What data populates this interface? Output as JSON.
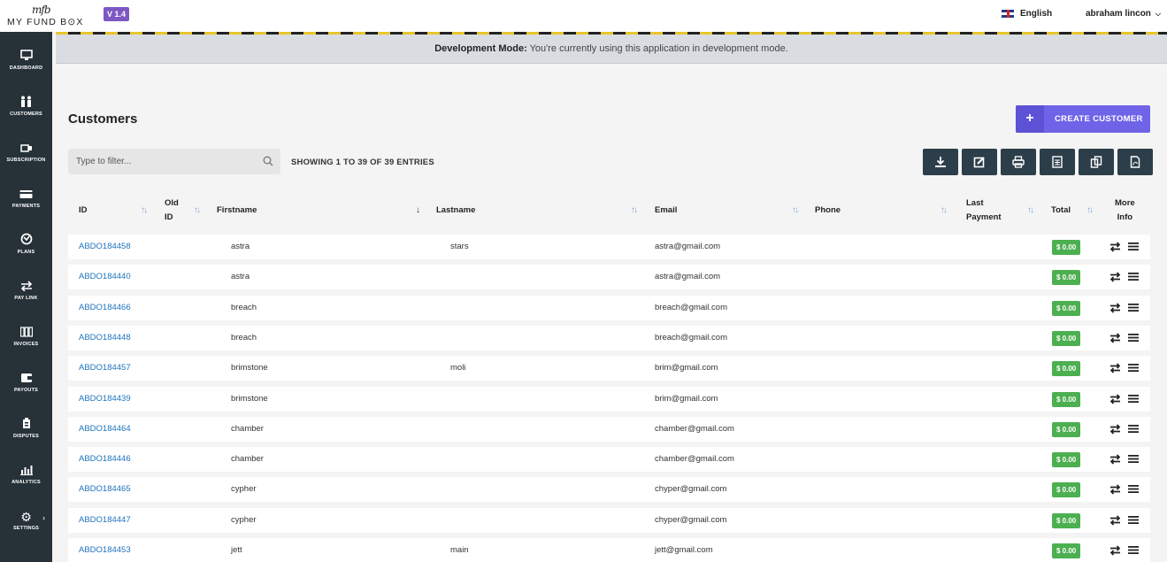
{
  "app": {
    "logo_mark": "mfb",
    "logo_name": "MY FUND B⊙X",
    "version": "V 1.4"
  },
  "header": {
    "language": "English",
    "user": "abraham lincon"
  },
  "sidebar": {
    "items": [
      {
        "label": "DASHBOARD",
        "icon": "monitor-icon"
      },
      {
        "label": "CUSTOMERS",
        "icon": "users-icon"
      },
      {
        "label": "SUBSCRIPTION",
        "icon": "subscription-icon"
      },
      {
        "label": "PAYMENTS",
        "icon": "credit-card-icon"
      },
      {
        "label": "PLANS",
        "icon": "plans-icon"
      },
      {
        "label": "PAY LINK",
        "icon": "exchange-icon"
      },
      {
        "label": "INVOICES",
        "icon": "invoice-icon"
      },
      {
        "label": "PAYOUTS",
        "icon": "wallet-icon"
      },
      {
        "label": "DISPUTES",
        "icon": "dispute-icon"
      },
      {
        "label": "ANALYTICS",
        "icon": "chart-icon"
      },
      {
        "label": "SETTINGS",
        "icon": "gear-icon"
      }
    ]
  },
  "banner": {
    "title": "Development Mode:",
    "message": " You're currently using this application in development mode."
  },
  "page": {
    "title": "Customers",
    "create_label": "CREATE CUSTOMER",
    "create_plus": "+",
    "filter_placeholder": "Type to filter...",
    "entries": "SHOWING 1 TO 39 OF 39 ENTRIES"
  },
  "toolbar": [
    "download-icon",
    "edit-icon",
    "print-icon",
    "csv-icon",
    "copy-icon",
    "pdf-icon"
  ],
  "table": {
    "columns": {
      "id": "ID",
      "old_id_1": "Old",
      "old_id_2": "ID",
      "firstname": "Firstname",
      "lastname": "Lastname",
      "email": "Email",
      "phone": "Phone",
      "last_payment_1": "Last",
      "last_payment_2": "Payment",
      "total": "Total",
      "more_1": "More",
      "more_2": "Info"
    },
    "rows": [
      {
        "id": "ABDO184458",
        "first": "astra",
        "last": "stars",
        "email": "astra@gmail.com",
        "total": "$ 0.00"
      },
      {
        "id": "ABDO184440",
        "first": "astra",
        "last": "",
        "email": "astra@gmail.com",
        "total": "$ 0.00"
      },
      {
        "id": "ABDO184466",
        "first": "breach",
        "last": "",
        "email": "breach@gmail.com",
        "total": "$ 0.00"
      },
      {
        "id": "ABDO184448",
        "first": "breach",
        "last": "",
        "email": "breach@gmail.com",
        "total": "$ 0.00"
      },
      {
        "id": "ABDO184457",
        "first": "brimstone",
        "last": "moli",
        "email": "brim@gmail.com",
        "total": "$ 0.00"
      },
      {
        "id": "ABDO184439",
        "first": "brimstone",
        "last": "",
        "email": "brim@gmail.com",
        "total": "$ 0.00"
      },
      {
        "id": "ABDO184464",
        "first": "chamber",
        "last": "",
        "email": "chamber@gmail.com",
        "total": "$ 0.00"
      },
      {
        "id": "ABDO184446",
        "first": "chamber",
        "last": "",
        "email": "chamber@gmail.com",
        "total": "$ 0.00"
      },
      {
        "id": "ABDO184465",
        "first": "cypher",
        "last": "",
        "email": "chyper@gmail.com",
        "total": "$ 0.00"
      },
      {
        "id": "ABDO184447",
        "first": "cypher",
        "last": "",
        "email": "chyper@gmail.com",
        "total": "$ 0.00"
      },
      {
        "id": "ABDO184453",
        "first": "jett",
        "last": "main",
        "email": "jett@gmail.com",
        "total": "$ 0.00"
      }
    ]
  },
  "colors": {
    "sidebar": "#263238",
    "accent": "#6f63e8",
    "link": "#1e73be",
    "badge": "#4caf50",
    "tool": "#2c3e4a"
  }
}
